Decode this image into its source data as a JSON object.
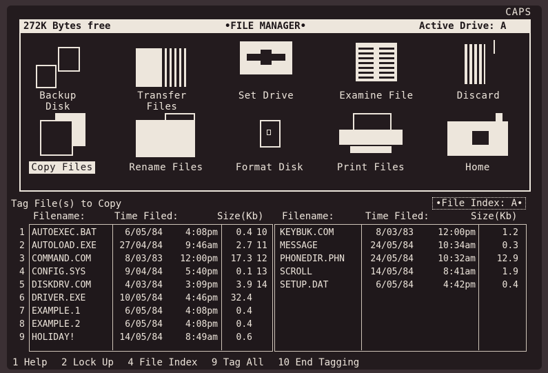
{
  "status": {
    "caps": "CAPS"
  },
  "titlebar": {
    "free": "272K Bytes free",
    "title": "•FILE MANAGER•",
    "drive": "Active Drive: A"
  },
  "icons": [
    {
      "label": "Backup Disk",
      "icon": "backup-disk-icon"
    },
    {
      "label": "Transfer Files",
      "icon": "transfer-files-icon"
    },
    {
      "label": "Set Drive",
      "icon": "set-drive-icon"
    },
    {
      "label": "Examine File",
      "icon": "examine-file-icon"
    },
    {
      "label": "Discard",
      "icon": "discard-icon"
    },
    {
      "label": "Copy Files",
      "icon": "copy-files-icon",
      "selected": true
    },
    {
      "label": "Rename Files",
      "icon": "rename-files-icon"
    },
    {
      "label": "Format Disk",
      "icon": "format-disk-icon"
    },
    {
      "label": "Print Files",
      "icon": "print-files-icon"
    },
    {
      "label": "Home",
      "icon": "home-icon"
    }
  ],
  "list": {
    "prompt": "Tag File(s) to Copy",
    "index": "•File Index: A•",
    "headers": {
      "filename": "Filename:",
      "time": "Time Filed:",
      "size": "Size(Kb)"
    },
    "left": [
      {
        "n": "1",
        "name": "AUTOEXEC.BAT",
        "date": "6/05/84",
        "time": "4:08pm",
        "size": "0.4"
      },
      {
        "n": "2",
        "name": "AUTOLOAD.EXE",
        "date": "27/04/84",
        "time": "9:46am",
        "size": "2.7"
      },
      {
        "n": "3",
        "name": "COMMAND.COM",
        "date": "8/03/83",
        "time": "12:00pm",
        "size": "17.3"
      },
      {
        "n": "4",
        "name": "CONFIG.SYS",
        "date": "9/04/84",
        "time": "5:40pm",
        "size": "0.1"
      },
      {
        "n": "5",
        "name": "DISKDRV.COM",
        "date": "4/03/84",
        "time": "3:09pm",
        "size": "3.9"
      },
      {
        "n": "6",
        "name": "DRIVER.EXE",
        "date": "10/05/84",
        "time": "4:46pm",
        "size": "32.4"
      },
      {
        "n": "7",
        "name": "EXAMPLE.1",
        "date": "6/05/84",
        "time": "4:08pm",
        "size": "0.4"
      },
      {
        "n": "8",
        "name": "EXAMPLE.2",
        "date": "6/05/84",
        "time": "4:08pm",
        "size": "0.4"
      },
      {
        "n": "9",
        "name": "HOLIDAY!",
        "date": "14/05/84",
        "time": "8:49am",
        "size": "0.6"
      }
    ],
    "right": [
      {
        "n": "10",
        "name": "KEYBUK.COM",
        "date": "8/03/83",
        "time": "12:00pm",
        "size": "1.2"
      },
      {
        "n": "11",
        "name": "MESSAGE",
        "date": "24/05/84",
        "time": "10:34am",
        "size": "0.3"
      },
      {
        "n": "12",
        "name": "PHONEDIR.PHN",
        "date": "24/05/84",
        "time": "10:32am",
        "size": "12.9"
      },
      {
        "n": "13",
        "name": "SCROLL",
        "date": "14/05/84",
        "time": "8:41am",
        "size": "1.9"
      },
      {
        "n": "14",
        "name": "SETUP.DAT",
        "date": "6/05/84",
        "time": "4:42pm",
        "size": "0.4"
      }
    ]
  },
  "fnkeys": [
    "1 Help",
    "2 Lock Up",
    "4 File Index",
    "9 Tag All",
    "10 End Tagging"
  ]
}
